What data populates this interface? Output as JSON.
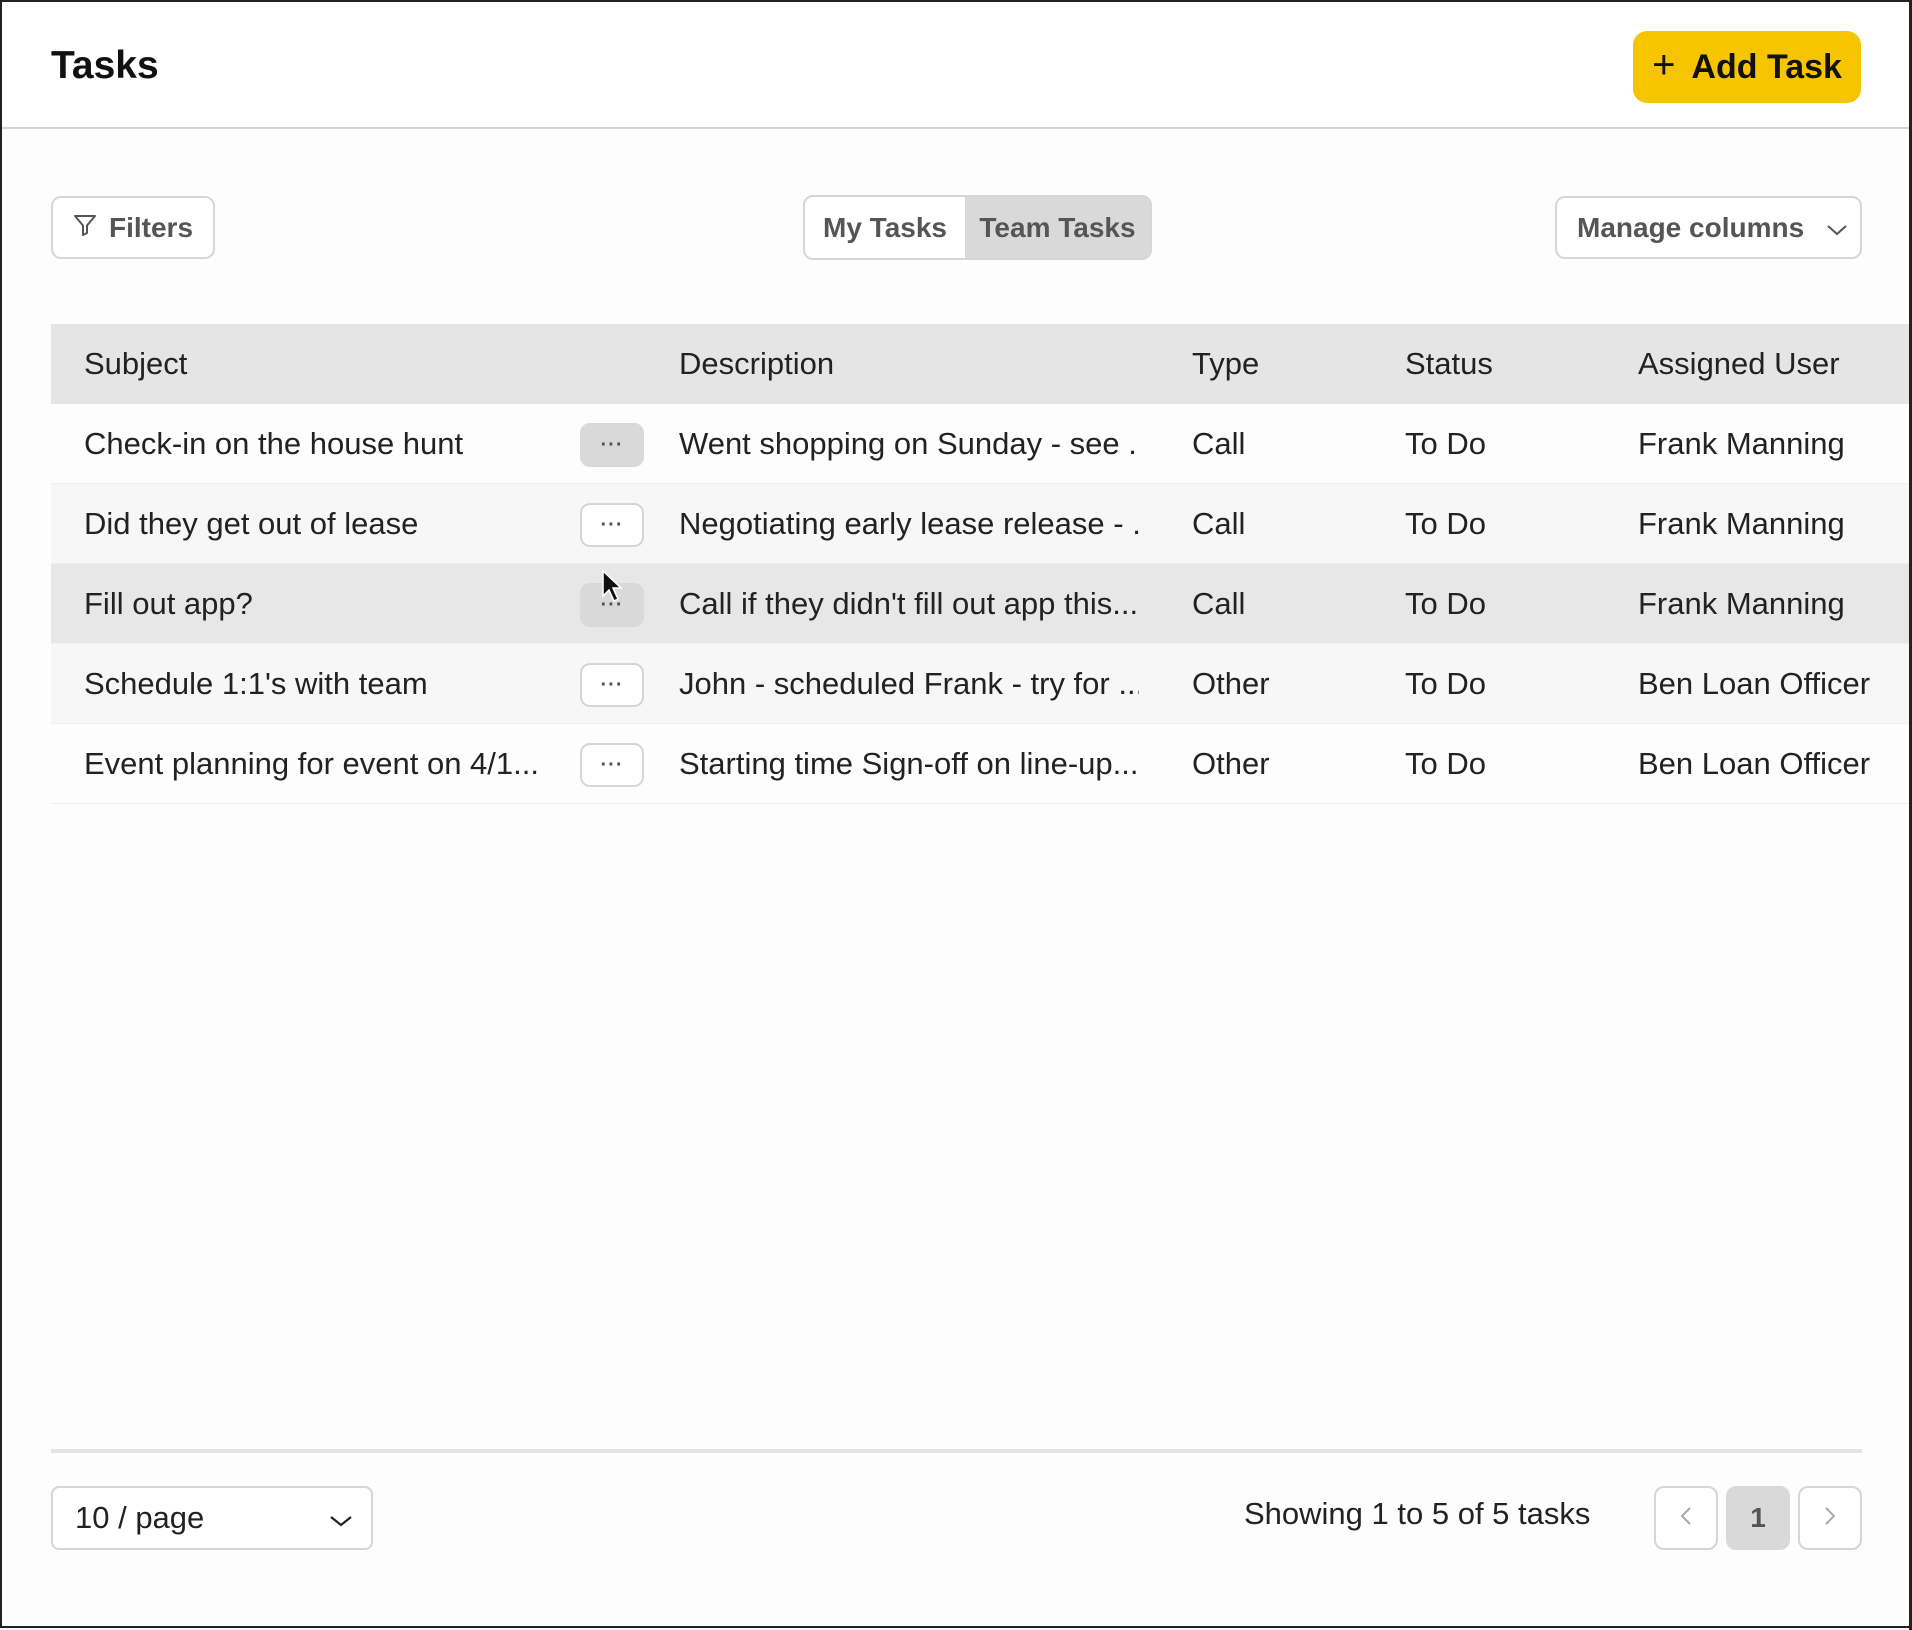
{
  "header": {
    "title": "Tasks",
    "add_task_label": "Add Task"
  },
  "toolbar": {
    "filters_label": "Filters",
    "toggle": [
      "My Tasks",
      "Team Tasks"
    ],
    "toggle_selected": "Team Tasks",
    "manage_columns_label": "Manage columns"
  },
  "table": {
    "columns": [
      "Subject",
      "Description",
      "Type",
      "Status",
      "Assigned User"
    ],
    "rows": [
      {
        "subject": "Check-in on the house hunt",
        "description": "Went shopping on Sunday - see ...",
        "type": "Call",
        "status": "To Do",
        "assigned_user": "Frank Manning",
        "more": "···"
      },
      {
        "subject": "Did they get out of lease",
        "description": "Negotiating early lease release - ...",
        "type": "Call",
        "status": "To Do",
        "assigned_user": "Frank Manning",
        "more": "···"
      },
      {
        "subject": "Fill out app?",
        "description": "Call if they didn't fill out app this...",
        "type": "Call",
        "status": "To Do",
        "assigned_user": "Frank Manning",
        "more": "···"
      },
      {
        "subject": "Schedule 1:1's with team",
        "description": "John - scheduled Frank - try for ...",
        "type": "Other",
        "status": "To Do",
        "assigned_user": "Ben Loan Officer",
        "more": "···"
      },
      {
        "subject": "Event planning for event on 4/1...",
        "description": "Starting time Sign-off on line-up...",
        "type": "Other",
        "status": "To Do",
        "assigned_user": "Ben Loan Officer",
        "more": "···"
      }
    ]
  },
  "footer": {
    "page_size": "10 / page",
    "showing": "Showing 1 to 5 of 5 tasks",
    "current_page": "1"
  },
  "colors": {
    "accent": "#f7c500",
    "header_row": "#e5e5e5",
    "selected_toggle": "#d9d9d9"
  }
}
